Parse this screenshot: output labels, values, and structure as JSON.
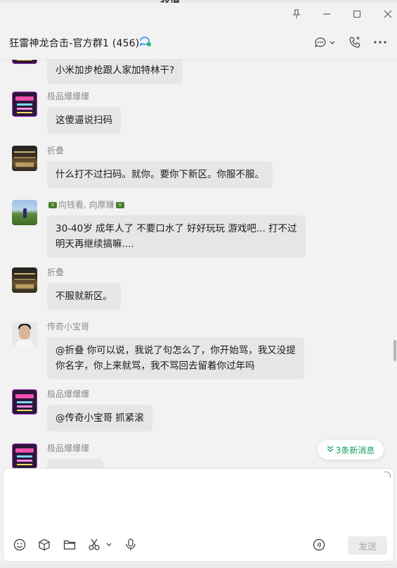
{
  "window": {
    "cut_title": "表情",
    "controls": [
      "pin-icon",
      "minimize-icon",
      "maximize-icon",
      "close-icon"
    ]
  },
  "header": {
    "title": "狂雷神龙合击-官方群1 (456)",
    "title_icon": "group-chat-icon",
    "actions": [
      "chat-bubble-icon",
      "phone-icon",
      "more-icon"
    ]
  },
  "messages": [
    {
      "sender": "",
      "text": "小米加步枪跟人家加特林干?",
      "avatar": "neon"
    },
    {
      "sender": "极品爆爆爆",
      "text": "这傻逼说扫码",
      "avatar": "neon"
    },
    {
      "sender": "折叠",
      "text": "什么打不过扫码。就你。要你下新区。你服不服。",
      "avatar": "building"
    },
    {
      "sender_prefix": "",
      "sender": "向钱看, 向厚赚",
      "text": "30-40岁 成年人了 不要口水了 好好玩玩 游戏吧... 打不过",
      "text2": "明天再继续搞嘛....",
      "avatar": "field"
    },
    {
      "sender": "折叠",
      "text": "不服就新区。",
      "avatar": "building"
    },
    {
      "sender": "传奇小宝哥",
      "text": "@折叠 你可以说，我说了句怎么了，你开始骂，我又没提",
      "text2": "你名字，你上来就骂，我不骂回去留着你过年吗",
      "avatar": "person"
    },
    {
      "sender": "极品爆爆爆",
      "text": "@传奇小宝哥 抓紧滚",
      "avatar": "neon"
    },
    {
      "sender": "极品爆爆爆",
      "text": "",
      "avatar": "neon"
    }
  ],
  "new_messages": "3条新消息",
  "input": {
    "tools": [
      "emoji-icon",
      "cube-icon",
      "folder-icon",
      "scissors-icon",
      "microphone-icon",
      "voice-message-icon"
    ],
    "send_label": "发送"
  }
}
